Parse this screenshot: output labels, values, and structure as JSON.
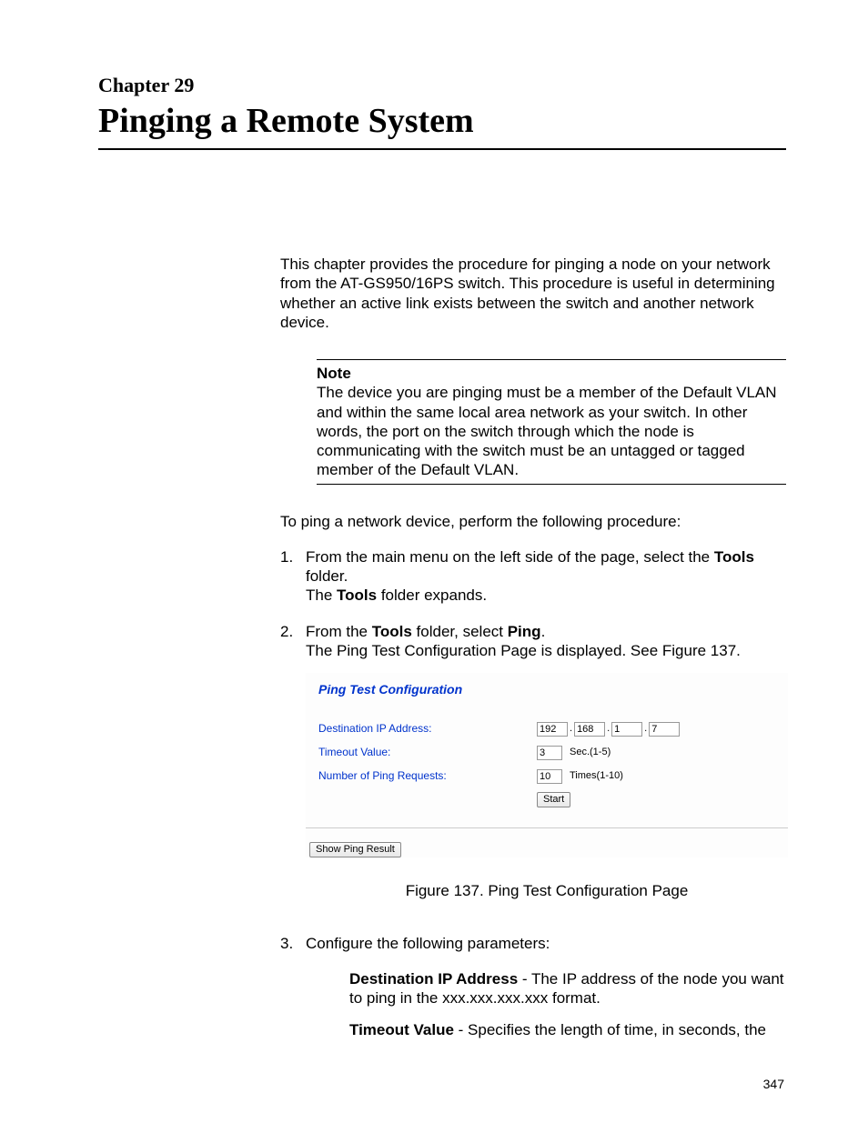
{
  "heading": {
    "chapter_label": "Chapter 29",
    "title": "Pinging a Remote System"
  },
  "intro": "This chapter provides the procedure for pinging a node on your network from the AT-GS950/16PS switch. This procedure is useful in determining whether an active link exists between the switch and another network device.",
  "note": {
    "label": "Note",
    "text": "The device you are pinging must be a member of the Default VLAN and within the same local area network as your switch. In other words, the port on the switch through which the node is communicating with the switch must be an untagged or tagged member of the Default VLAN."
  },
  "lead_in": "To ping a network device, perform the following procedure:",
  "steps": [
    {
      "num": "1.",
      "l1a": "From the main menu on the left side of the page, select the ",
      "l1b": "Tools",
      "l1c": " folder.",
      "l2a": "The ",
      "l2b": "Tools",
      "l2c": " folder expands."
    },
    {
      "num": "2.",
      "l1a": "From the ",
      "l1b": "Tools",
      "l1c": " folder, select ",
      "l1d": "Ping",
      "l1e": ".",
      "l2": "The Ping Test Configuration Page is displayed. See Figure 137."
    },
    {
      "num": "3.",
      "l1": "Configure the following parameters:"
    }
  ],
  "figure": {
    "title": "Ping Test Configuration",
    "rows": {
      "dest_label": "Destination IP Address:",
      "ip": [
        "192",
        "168",
        "1",
        "7"
      ],
      "timeout_label": "Timeout Value:",
      "timeout_value": "3",
      "timeout_hint": "Sec.(1-5)",
      "count_label": "Number of Ping Requests:",
      "count_value": "10",
      "count_hint": "Times(1-10)"
    },
    "start_btn": "Start",
    "show_btn": "Show Ping Result",
    "caption": "Figure 137. Ping Test Configuration Page"
  },
  "defs": {
    "d1_label": "Destination IP Address",
    "d1_text": " - The IP address of the node you want to ping in the xxx.xxx.xxx.xxx format.",
    "d2_label": "Timeout Value",
    "d2_text": " - Specifies the length of time, in seconds, the"
  },
  "page_number": "347"
}
